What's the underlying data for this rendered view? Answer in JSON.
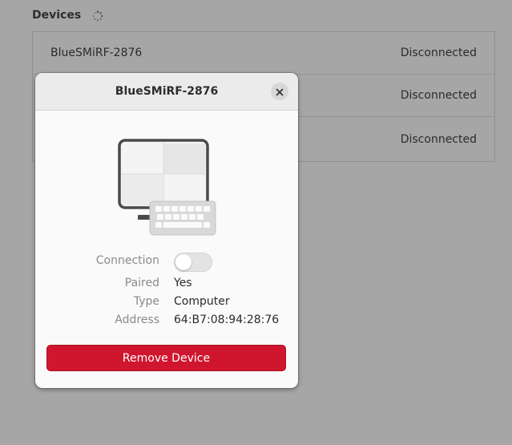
{
  "devices": {
    "title": "Devices",
    "items": [
      {
        "name": "BlueSMiRF-2876",
        "status": "Disconnected"
      },
      {
        "name": "",
        "status": "Disconnected"
      },
      {
        "name": "",
        "status": "Disconnected"
      }
    ]
  },
  "dialog": {
    "title": "BlueSMiRF-2876",
    "icon": "computer-icon",
    "connection": {
      "label": "Connection",
      "enabled": false
    },
    "paired": {
      "label": "Paired",
      "value": "Yes"
    },
    "type": {
      "label": "Type",
      "value": "Computer"
    },
    "address": {
      "label": "Address",
      "value": "64:B7:08:94:28:76"
    },
    "remove_label": "Remove Device"
  },
  "colors": {
    "background": "#a6a6a6",
    "dialog_bg": "#fafafa",
    "destructive": "#d0162e"
  }
}
